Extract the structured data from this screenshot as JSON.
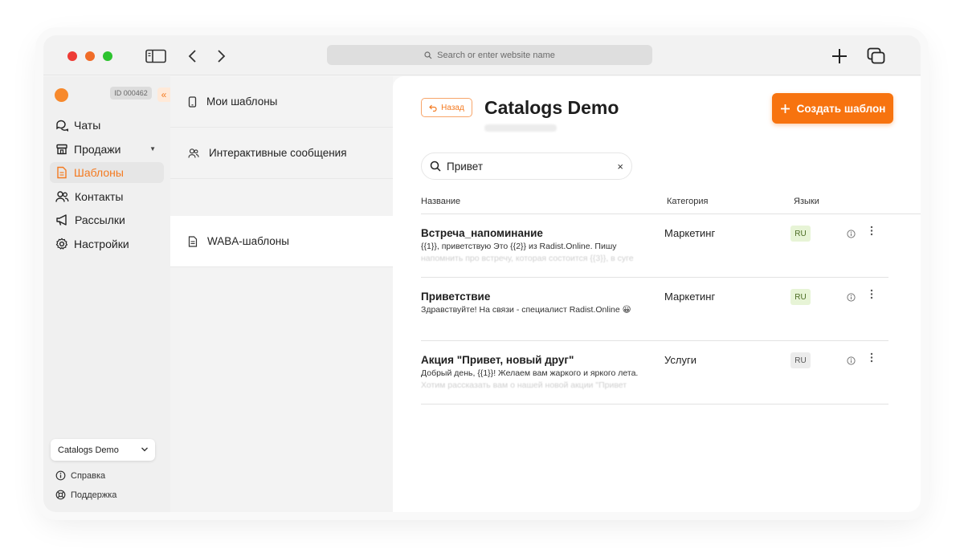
{
  "browser": {
    "url_placeholder": "Search or enter website name",
    "colors": {
      "close": "#ee3b35",
      "minimize": "#f06c28",
      "maximize": "#2dc32f"
    }
  },
  "sidebar": {
    "account_id": "ID 000462",
    "collapse_glyph": "«",
    "items": [
      {
        "label": "Чаты",
        "icon": "chat-icon"
      },
      {
        "label": "Продажи",
        "icon": "store-icon",
        "caret": "▼"
      },
      {
        "label": "Шаблоны",
        "icon": "document-icon",
        "active": true
      },
      {
        "label": "Контакты",
        "icon": "people-icon"
      },
      {
        "label": "Рассылки",
        "icon": "megaphone-icon"
      },
      {
        "label": "Настройки",
        "icon": "gear-icon"
      }
    ],
    "workspace": "Catalogs Demo",
    "help": "Справка",
    "support": "Поддержка",
    "accent_color": "#f47a20"
  },
  "submenu": {
    "items": [
      {
        "label": "Мои шаблоны",
        "icon": "phone-icon"
      },
      {
        "label": "Интерактивные сообщения",
        "icon": "people-icon"
      },
      {
        "label": "WABA-шаблоны",
        "icon": "document-icon",
        "active": true
      }
    ]
  },
  "main": {
    "back_label": "Назад",
    "title": "Catalogs Demo",
    "create_label": "Создать шаблон",
    "search": {
      "value": "Привет",
      "clear_glyph": "×"
    },
    "columns": {
      "name": "Название",
      "category": "Категория",
      "languages": "Языки"
    },
    "rows": [
      {
        "title": "Встреча_напоминание",
        "desc": "{{1}}, приветствую Это {{2}} из Radist.Online. Пишу",
        "desc_more": "напомнить про встречу, которая состоится {{3}}, в суге",
        "category": "Маркетинг",
        "lang": "RU",
        "lang_status": "approved"
      },
      {
        "title": "Приветствие",
        "desc": "Здравствуйте! На связи - специалист Radist.Online 😀",
        "desc_more": "",
        "category": "Маркетинг",
        "lang": "RU",
        "lang_status": "approved"
      },
      {
        "title": "Акция \"Привет, новый друг\"",
        "desc": "Добрый день, {{1}}! Желаем вам жаркого и яркого лета.",
        "desc_more": "Хотим рассказать вам о нашей новой акции \"Привет",
        "category": "Услуги",
        "lang": "RU",
        "lang_status": "pending"
      }
    ],
    "primary_color": "#f7730f"
  }
}
